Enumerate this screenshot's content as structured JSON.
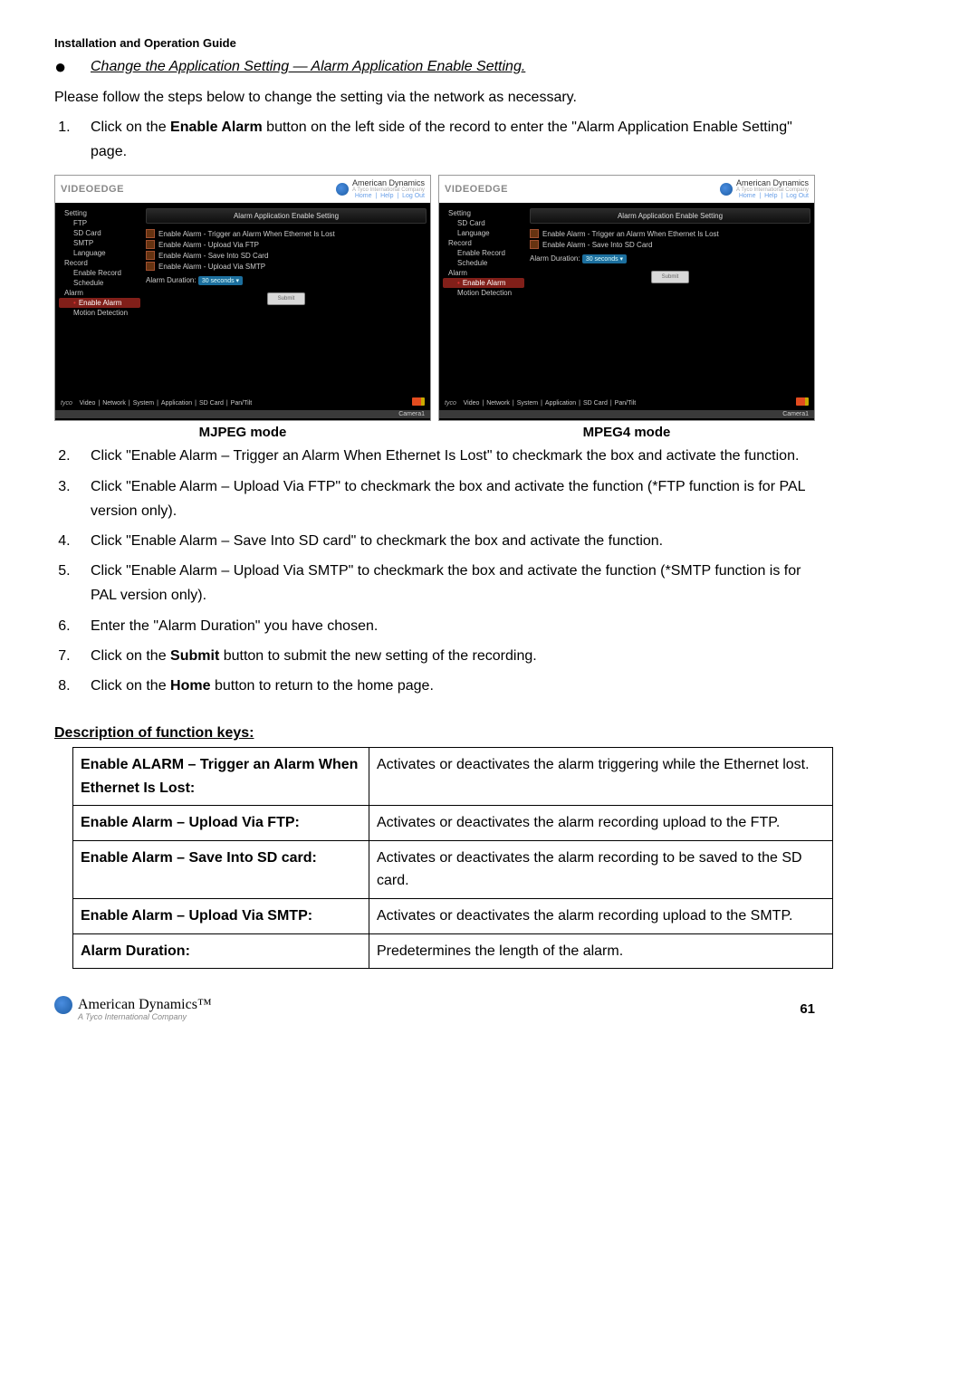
{
  "header": "Installation and Operation Guide",
  "bullet_heading": "Change the Application Setting — Alarm Application Enable Setting.",
  "intro": "Please follow the steps below to change the setting via the network as necessary.",
  "steps": [
    {
      "pre": "Click on the ",
      "bold": "Enable Alarm",
      "post": " button on the left side of the record to enter the \"Alarm Application Enable Setting\" page."
    },
    {
      "text": "Click \"Enable Alarm – Trigger an Alarm When Ethernet Is Lost\" to checkmark the box and activate the function."
    },
    {
      "text": "Click \"Enable Alarm – Upload Via FTP\" to checkmark the box and activate the function (*FTP function is for PAL version only)."
    },
    {
      "text": "Click \"Enable Alarm – Save Into SD card\" to checkmark the box and activate the function."
    },
    {
      "text": "Click \"Enable Alarm – Upload Via SMTP\" to checkmark the box and activate the function (*SMTP function is for PAL version only)."
    },
    {
      "text": "Enter the \"Alarm Duration\" you have chosen."
    },
    {
      "pre": "Click on the ",
      "bold": "Submit",
      "post": " button to submit the new setting of the recording."
    },
    {
      "pre": "Click on the ",
      "bold": "Home",
      "post": " button to return to the home page."
    }
  ],
  "shots": {
    "left": {
      "brand": "VIDEOEDGE",
      "ad": "American Dynamics",
      "ad_sub": "A Tyco International Company",
      "links": [
        "Home",
        "Help",
        "Log Out"
      ],
      "panel_title": "Alarm Application Enable Setting",
      "side": [
        "Setting",
        "FTP",
        "SD Card",
        "SMTP",
        "Language",
        "Record",
        "Enable Record",
        "Schedule",
        "Alarm",
        "Enable Alarm",
        "Motion Detection"
      ],
      "side_sub_idx": [
        1,
        2,
        3,
        4,
        6,
        7,
        9,
        10
      ],
      "side_active_idx": 9,
      "checks": [
        "Enable Alarm - Trigger an Alarm When Ethernet Is Lost",
        "Enable Alarm - Upload Via FTP",
        "Enable Alarm - Save Into SD Card",
        "Enable Alarm - Upload Via SMTP"
      ],
      "duration_label": "Alarm Duration:",
      "duration_value": "30 seconds",
      "submit": "Submit",
      "tabs": [
        "Video",
        "Network",
        "System",
        "Application",
        "SD Card",
        "Pan/Tilt"
      ],
      "tyco": "tyco",
      "camera": "Camera1",
      "caption": "MJPEG mode"
    },
    "right": {
      "brand": "VIDEOEDGE",
      "ad": "American Dynamics",
      "ad_sub": "A Tyco International Company",
      "links": [
        "Home",
        "Help",
        "Log Out"
      ],
      "panel_title": "Alarm Application Enable Setting",
      "side": [
        "Setting",
        "SD Card",
        "Language",
        "Record",
        "Enable Record",
        "Schedule",
        "Alarm",
        "Enable Alarm",
        "Motion Detection"
      ],
      "side_sub_idx": [
        1,
        2,
        4,
        5,
        7,
        8
      ],
      "side_active_idx": 7,
      "checks": [
        "Enable Alarm - Trigger an Alarm When Ethernet Is Lost",
        "Enable Alarm - Save Into SD Card"
      ],
      "duration_label": "Alarm Duration:",
      "duration_value": "30 seconds",
      "submit": "Submit",
      "tabs": [
        "Video",
        "Network",
        "System",
        "Application",
        "SD Card",
        "Pan/Tilt"
      ],
      "tyco": "tyco",
      "camera": "Camera1",
      "caption": "MPEG4 mode"
    }
  },
  "func_heading": "Description of function keys:",
  "func_table": [
    {
      "k": "Enable ALARM – Trigger an Alarm When Ethernet Is Lost:",
      "v": "Activates or deactivates the alarm triggering while the Ethernet lost."
    },
    {
      "k": "Enable Alarm – Upload Via FTP:",
      "v": "Activates or deactivates the alarm recording upload to the FTP."
    },
    {
      "k": "Enable Alarm – Save Into SD card:",
      "v": "Activates or deactivates the alarm recording to be saved to the SD card."
    },
    {
      "k": "Enable Alarm – Upload Via SMTP:",
      "v": "Activates or deactivates the alarm recording upload to the SMTP."
    },
    {
      "k": "Alarm Duration:",
      "v": "Predetermines the length of the alarm."
    }
  ],
  "footer_brand": "American Dynamics",
  "footer_sub": "A Tyco International Company",
  "page_num": "61"
}
